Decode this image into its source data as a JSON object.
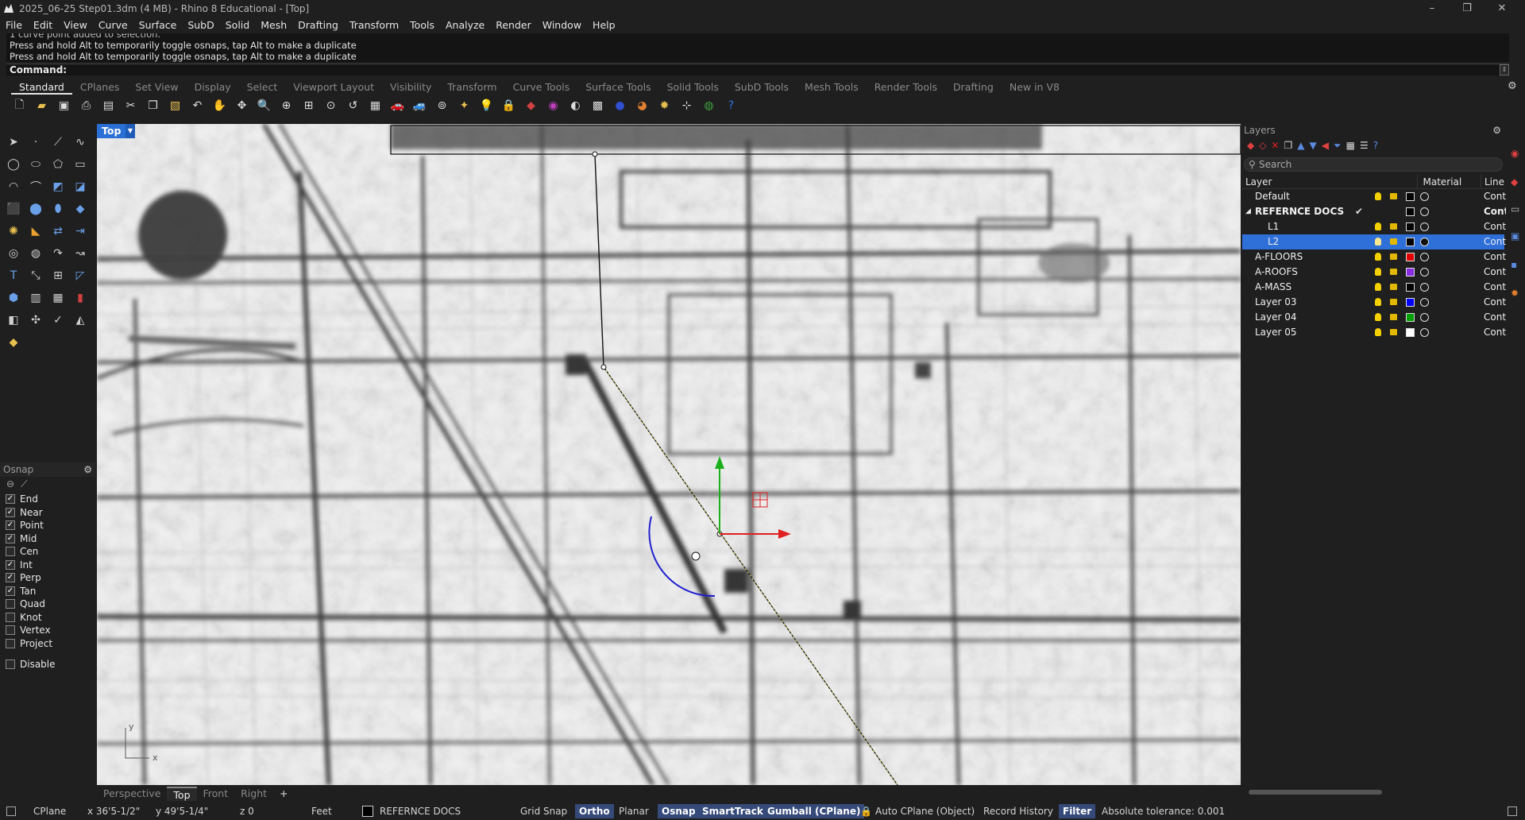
{
  "window": {
    "title": "2025_06-25 Step01.3dm (4 MB) - Rhino 8 Educational - [Top]",
    "controls": [
      "–",
      "❐",
      "✕"
    ]
  },
  "menu": [
    "File",
    "Edit",
    "View",
    "Curve",
    "Surface",
    "SubD",
    "Solid",
    "Mesh",
    "Drafting",
    "Transform",
    "Tools",
    "Analyze",
    "Render",
    "Window",
    "Help"
  ],
  "command_history": {
    "partial": "1 curve point added to selection.",
    "lines": [
      "Press and hold Alt to temporarily toggle osnaps, tap Alt to make a duplicate",
      "Press and hold Alt to temporarily toggle osnaps, tap Alt to make a duplicate"
    ],
    "prompt": "Command:"
  },
  "toolbar_tabs": [
    "Standard",
    "CPlanes",
    "Set View",
    "Display",
    "Select",
    "Viewport Layout",
    "Visibility",
    "Transform",
    "Curve Tools",
    "Surface Tools",
    "Solid Tools",
    "SubD Tools",
    "Mesh Tools",
    "Render Tools",
    "Drafting",
    "New in V8"
  ],
  "active_toolbar_tab": "Standard",
  "viewport": {
    "label": "Top",
    "tabs": [
      "Perspective",
      "Top",
      "Front",
      "Right"
    ],
    "active_tab": "Top",
    "add_tab": "+",
    "axis_y": "y",
    "axis_x": "x"
  },
  "osnap": {
    "title": "Osnap",
    "items": [
      {
        "label": "End",
        "checked": true
      },
      {
        "label": "Near",
        "checked": true
      },
      {
        "label": "Point",
        "checked": true
      },
      {
        "label": "Mid",
        "checked": true
      },
      {
        "label": "Cen",
        "checked": false
      },
      {
        "label": "Int",
        "checked": true
      },
      {
        "label": "Perp",
        "checked": true
      },
      {
        "label": "Tan",
        "checked": true
      },
      {
        "label": "Quad",
        "checked": false
      },
      {
        "label": "Knot",
        "checked": false
      },
      {
        "label": "Vertex",
        "checked": false
      },
      {
        "label": "Project",
        "checked": false
      }
    ],
    "disable": {
      "label": "Disable",
      "checked": false
    }
  },
  "layers": {
    "title": "Layers",
    "search_placeholder": "Search",
    "col_layer": "Layer",
    "col_material": "Material",
    "col_line": "Line",
    "rows": [
      {
        "name": "Default",
        "color": "#000000",
        "line": "Cont",
        "indent": 0,
        "bold": false,
        "selected": false,
        "bulb": true,
        "current": false
      },
      {
        "name": "REFERNCE DOCS",
        "color": "#000000",
        "line": "Cont",
        "indent": 0,
        "bold": true,
        "selected": false,
        "bulb": false,
        "current": true,
        "expanded": true
      },
      {
        "name": "L1",
        "color": "#000000",
        "line": "Cont",
        "indent": 1,
        "bold": false,
        "selected": false,
        "bulb": true,
        "current": false
      },
      {
        "name": "L2",
        "color": "#000000",
        "line": "Cont",
        "indent": 1,
        "bold": false,
        "selected": true,
        "bulb": true,
        "current": false
      },
      {
        "name": "A-FLOORS",
        "color": "#e00000",
        "line": "Cont",
        "indent": 0,
        "bold": false,
        "selected": false,
        "bulb": true,
        "current": false
      },
      {
        "name": "A-ROOFS",
        "color": "#8a2be2",
        "line": "Cont",
        "indent": 0,
        "bold": false,
        "selected": false,
        "bulb": true,
        "current": false
      },
      {
        "name": "A-MASS",
        "color": "#000000",
        "line": "Cont",
        "indent": 0,
        "bold": false,
        "selected": false,
        "bulb": true,
        "current": false
      },
      {
        "name": "Layer 03",
        "color": "#0000ff",
        "line": "Cont",
        "indent": 0,
        "bold": false,
        "selected": false,
        "bulb": true,
        "current": false
      },
      {
        "name": "Layer 04",
        "color": "#00a000",
        "line": "Cont",
        "indent": 0,
        "bold": false,
        "selected": false,
        "bulb": true,
        "current": false
      },
      {
        "name": "Layer 05",
        "color": "#ffffff",
        "line": "Cont",
        "indent": 0,
        "bold": false,
        "selected": false,
        "bulb": true,
        "current": false
      }
    ]
  },
  "status": {
    "cplane": "CPlane",
    "x": "x 36'5-1/2\"",
    "y": "y 49'5-1/4\"",
    "z": "z 0",
    "units": "Feet",
    "layer": "REFERNCE DOCS",
    "grid_snap": "Grid Snap",
    "ortho": "Ortho",
    "planar": "Planar",
    "osnap": "Osnap",
    "smarttrack": "SmartTrack",
    "gumball": "Gumball (CPlane)",
    "autocplane": "Auto CPlane (Object)",
    "record_history": "Record History",
    "filter": "Filter",
    "tolerance": "Absolute tolerance: 0.001"
  },
  "colors": {
    "accent": "#2e6fd8",
    "status_active": "#364a7a"
  }
}
